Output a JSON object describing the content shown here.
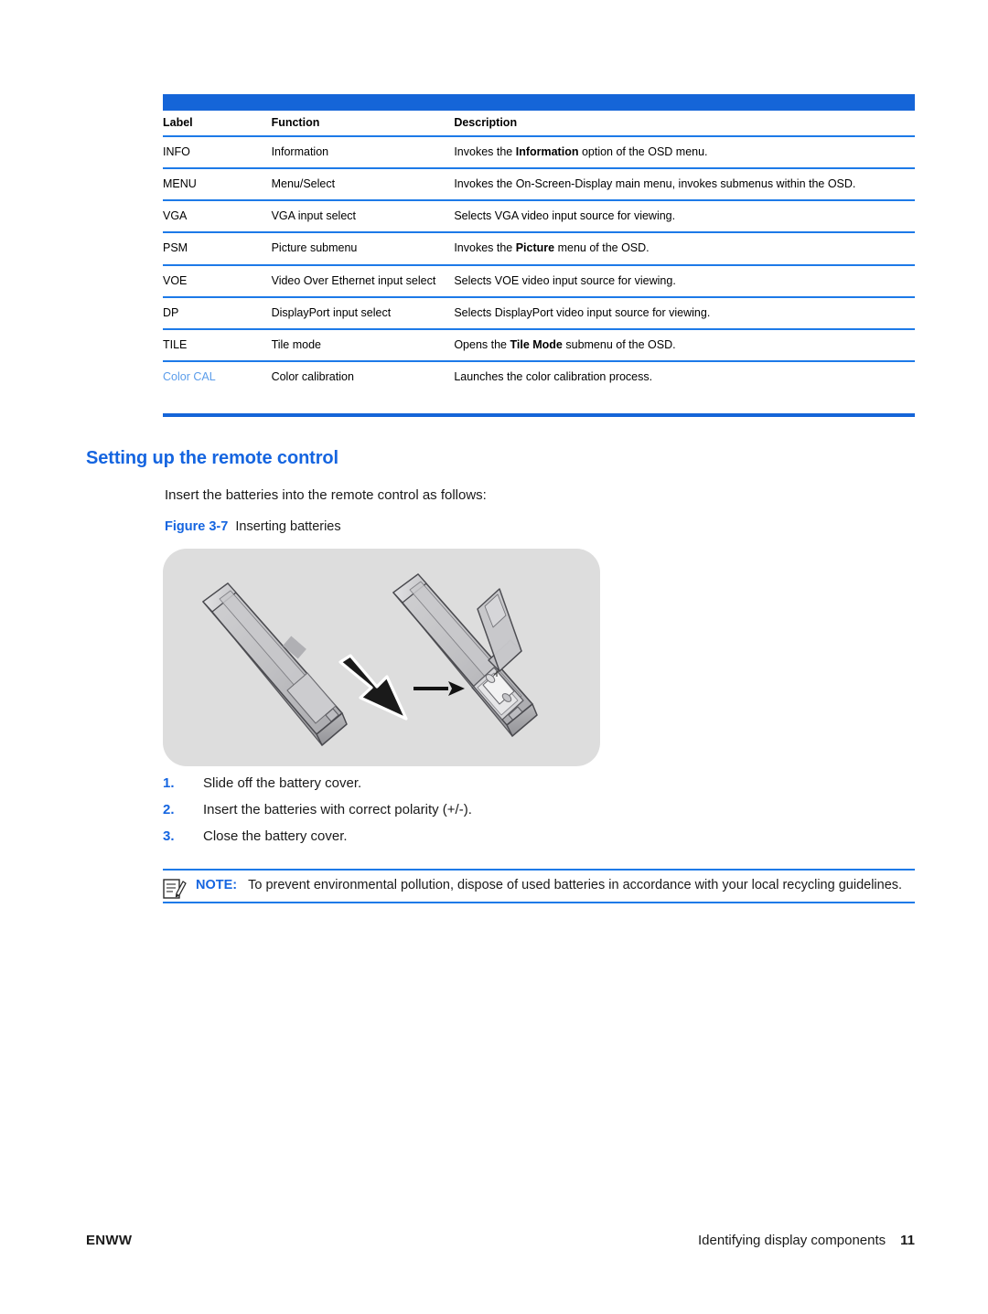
{
  "table": {
    "headers": [
      "Label",
      "Function",
      "Description"
    ],
    "rows": [
      {
        "label": "INFO",
        "function": "Information",
        "description_pre": "Invokes the ",
        "description_bold": "Information",
        "description_post": " option of the OSD menu."
      },
      {
        "label": "MENU",
        "function": "Menu/Select",
        "description_pre": "Invokes the On-Screen-Display main menu, invokes submenus within the OSD.",
        "description_bold": "",
        "description_post": ""
      },
      {
        "label": "VGA",
        "function": "VGA input select",
        "description_pre": "Selects VGA video input source for viewing.",
        "description_bold": "",
        "description_post": ""
      },
      {
        "label": "PSM",
        "function": "Picture submenu",
        "description_pre": "Invokes the ",
        "description_bold": "Picture",
        "description_post": " menu of the OSD."
      },
      {
        "label": "VOE",
        "function": "Video Over Ethernet input select",
        "description_pre": "Selects VOE video input source for viewing.",
        "description_bold": "",
        "description_post": ""
      },
      {
        "label": "DP",
        "function": "DisplayPort input select",
        "description_pre": "Selects DisplayPort video input source for viewing.",
        "description_bold": "",
        "description_post": ""
      },
      {
        "label": "TILE",
        "function": "Tile mode",
        "description_pre": "Opens the ",
        "description_bold": "Tile Mode",
        "description_post": " submenu of the OSD."
      },
      {
        "label": "Color CAL",
        "function": "Color calibration",
        "description_pre": "Launches the color calibration process.",
        "description_bold": "",
        "description_post": ""
      }
    ]
  },
  "section": {
    "heading": "Setting up the remote control",
    "intro": "Insert the batteries into the remote control as follows:"
  },
  "figure": {
    "number": "Figure 3-7",
    "title": "Inserting batteries",
    "background_color": "#dddddd"
  },
  "steps": [
    {
      "num": "1.",
      "text": "Slide off the battery cover."
    },
    {
      "num": "2.",
      "text": "Insert the batteries with correct polarity (+/-)."
    },
    {
      "num": "3.",
      "text": "Close the battery cover."
    }
  ],
  "note": {
    "label": "NOTE:",
    "text": "To prevent environmental pollution, dispose of used batteries in accordance with your local recycling guidelines.",
    "icon": "note-pencil-icon"
  },
  "footer": {
    "left": "ENWW",
    "right": "Identifying display components",
    "page": "11"
  },
  "colors": {
    "accent_blue": "#1565e0",
    "rule_blue": "#1d7ae8",
    "label_blue": "#1b7ae8",
    "label_blue_soft": "#5a9cea",
    "text": "#1a1a1a"
  }
}
